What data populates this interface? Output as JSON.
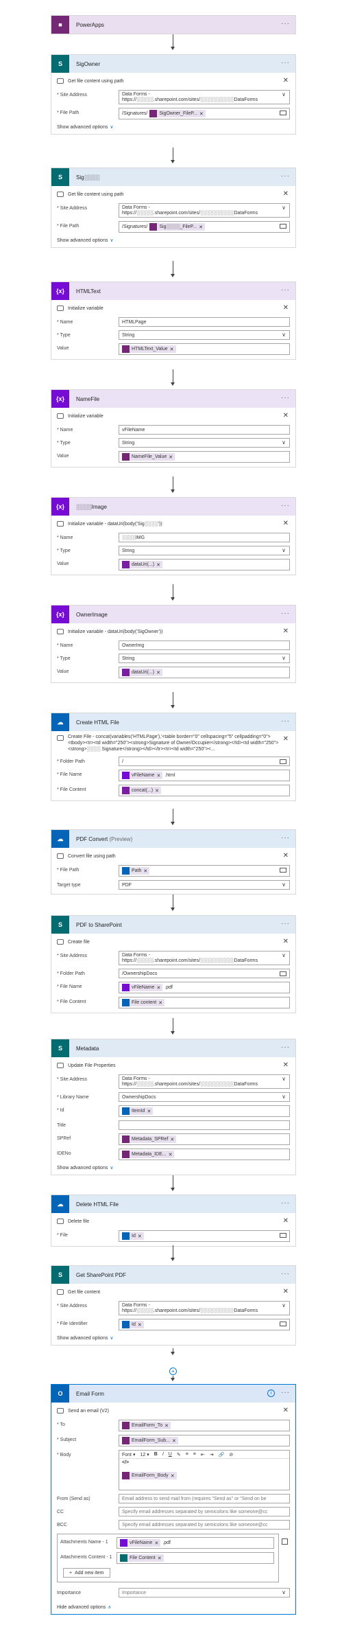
{
  "steps": {
    "powerapps": {
      "title": "PowerApps",
      "dots": "···"
    },
    "sigowner": {
      "title": "SigOwner",
      "sub": "Get file content using path",
      "site_label": "* Site Address",
      "site_line1": "Data Forms -",
      "site_line2": "https://░░░░░.sharepoint.com/sites/░░░░░░░░░░DataForms",
      "path_label": "* File Path",
      "path_prefix": "/Signatures/",
      "path_token": "SigOwner_FileP...",
      "adv": "Show advanced options"
    },
    "sig": {
      "title": "Sig░░░░",
      "sub": "Get file content using path",
      "site_label": "* Site Address",
      "site_line1": "Data Forms -",
      "site_line2": "https://░░░░░.sharepoint.com/sites/░░░░░░░░░░DataForms",
      "path_label": "* File Path",
      "path_prefix": "/Signatures/",
      "path_token": "Sig░░░░_FileP...",
      "adv": "Show advanced options"
    },
    "htmltext": {
      "title": "HTMLText",
      "sub": "Initialize variable",
      "name_label": "* Name",
      "name_value": "HTMLPage",
      "type_label": "* Type",
      "type_value": "String",
      "value_label": "Value",
      "value_token": "HTMLText_Value"
    },
    "namefile": {
      "title": "NameFile",
      "sub": "Initialize variable",
      "name_label": "* Name",
      "name_value": "vFileName",
      "type_label": "* Type",
      "type_value": "String",
      "value_label": "Value",
      "value_token": "NameFile_Value"
    },
    "image": {
      "title": "░░░░Image",
      "sub": "Initialize variable - dataUri(body('Sig░░░░'))",
      "name_label": "* Name",
      "name_value": "░░░░IMG",
      "type_label": "* Type",
      "type_value": "String",
      "value_label": "Value",
      "value_token": "dataUri(...)"
    },
    "ownerimage": {
      "title": "OwnerImage",
      "sub": "Initialize variable - dataUri(body('SigOwner'))",
      "name_label": "* Name",
      "name_value": "OwnerImg",
      "type_label": "* Type",
      "type_value": "String",
      "value_label": "Value",
      "value_token": "dataUri(...)"
    },
    "createhtml": {
      "title": "Create HTML File",
      "sub": "Create File - concat(variables('HTMLPage'),'<table border=\"0\" cellspacing=\"5\" cellpadding=\"0\"><tbody><tr><td width=\"250\"><strong>Signature of Owner/Occupier</strong></td><td width=\"250\"><strong>░░░░ Signature</strong></td></tr><tr><td width=\"250\"><...",
      "folder_label": "* Folder Path",
      "folder_value": "/",
      "name_label": "* File Name",
      "name_token": "vFileName",
      "name_suffix": ".html",
      "content_label": "* File Content",
      "content_token": "concat(...)"
    },
    "pdfconvert": {
      "title": "PDF Convert",
      "title_suffix": "(Preview)",
      "sub": "Convert file using path",
      "path_label": "* File Path",
      "path_token": "Path",
      "target_label": "Target type",
      "target_value": "PDF"
    },
    "pdf2sp": {
      "title": "PDF to SharePoint",
      "sub": "Create file",
      "site_label": "* Site Address",
      "site_line1": "Data Forms -",
      "site_line2": "https://░░░░░.sharepoint.com/sites/░░░░░░░░░░DataForms",
      "folder_label": "* Folder Path",
      "folder_value": "/OwnershipDocs",
      "name_label": "* File Name",
      "name_token": "vFileName",
      "name_suffix": ".pdf",
      "content_label": "* File Content",
      "content_token": "File content"
    },
    "metadata": {
      "title": "Metadata",
      "sub": "Update File Properties",
      "site_label": "* Site Address",
      "site_line1": "Data Forms -",
      "site_line2": "https://░░░░░.sharepoint.com/sites/░░░░░░░░░░DataForms",
      "lib_label": "* Library Name",
      "lib_value": "OwnershipDocs",
      "id_label": "* Id",
      "id_token": "ItemId",
      "title_label": "Title",
      "spref_label": "SPRef",
      "spref_token": "Metadata_SPRef",
      "ideno_label": "IDENo",
      "ideno_token": "Metadata_IDE...",
      "adv": "Show advanced options"
    },
    "deletehtml": {
      "title": "Delete HTML File",
      "sub": "Delete file",
      "file_label": "* File",
      "file_token": "Id"
    },
    "getsppdf": {
      "title": "Get SharePoint PDF",
      "sub": "Get file content",
      "site_label": "* Site Address",
      "site_line1": "Data Forms -",
      "site_line2": "https://░░░░░.sharepoint.com/sites/░░░░░░░░░░DataForms",
      "fid_label": "* File Identifier",
      "fid_token": "Id",
      "adv": "Show advanced options"
    },
    "emailform": {
      "title": "Email Form",
      "sub": "Send an email (V2)",
      "to_label": "* To",
      "to_token": "EmailForm_To",
      "subject_label": "* Subject",
      "subject_token": "EmailForm_Sub...",
      "body_label": "* Body",
      "font_label": "Font",
      "font_size": "12",
      "code_label": "</>",
      "body_token": "EmailForm_Body",
      "from_label": "From (Send as)",
      "from_placeholder": "Email address to send mail from (requires \"Send as\" or \"Send on be",
      "cc_label": "CC",
      "cc_placeholder": "Specify email addresses separated by semicolons like someone@cc",
      "bcc_label": "BCC",
      "bcc_placeholder": "Specify email addresses separated by semicolons like someone@cc",
      "att_name_label": "Attachments Name - 1",
      "att_name_token": "vFileName",
      "att_name_suffix": ".pdf",
      "att_content_label": "Attachments Content - 1",
      "att_content_token": "File Content",
      "add_new": "Add new item",
      "importance_label": "Importance",
      "importance_value": "Importance",
      "hide_adv": "Hide advanced options"
    }
  }
}
